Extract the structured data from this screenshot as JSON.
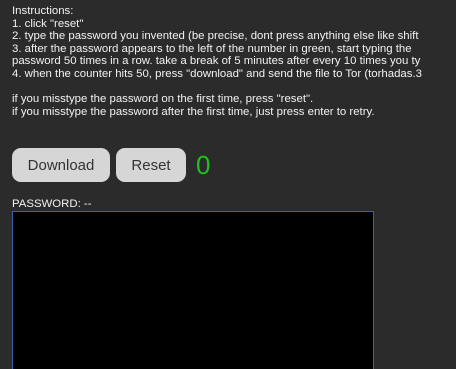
{
  "instructions": {
    "heading": "Instructions:",
    "steps": [
      "1. click \"reset\"",
      "2. type the password you invented (be precise, dont press anything else like shift",
      "3. after the password appears to the left of the number in green, start typing the",
      "password 50 times in a row. take a break of 5 minutes after every 10 times you ty",
      "4. when the counter hits 50, press \"download\" and send the file to Tor (torhadas.3"
    ],
    "notes": [
      "if you misstype the password on the first time, press \"reset\".",
      "if you misstype the password after the first time, just press enter to retry."
    ]
  },
  "controls": {
    "download_label": "Download",
    "reset_label": "Reset",
    "counter": "0"
  },
  "password": {
    "label": "PASSWORD: --",
    "value": ""
  },
  "colors": {
    "background": "#2b2b2b",
    "counter_green": "#1ec11e",
    "button_bg": "#d6d6d6",
    "textarea_border": "#3c5fa8"
  }
}
